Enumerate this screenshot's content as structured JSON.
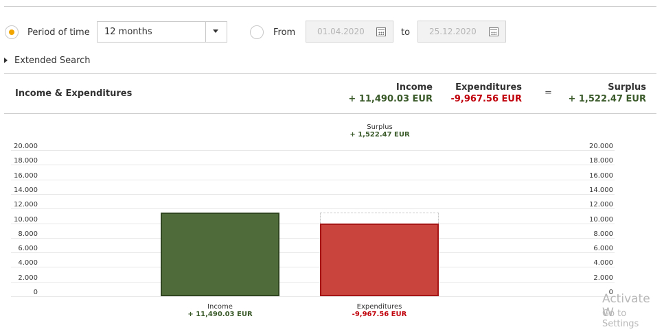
{
  "filter": {
    "period_label": "Period of time",
    "period_value": "12 months",
    "from_label": "From",
    "from_date": "01.04.2020",
    "to_label": "to",
    "to_date": "25.12.2020",
    "extended_search": "Extended Search",
    "selected": "period"
  },
  "summary": {
    "title": "Income & Expenditures",
    "income_label": "Income",
    "income_value": "+ 11,490.03 EUR",
    "expenditures_label": "Expenditures",
    "expenditures_value": "-9,967.56 EUR",
    "equals": "=",
    "surplus_label": "Surplus",
    "surplus_value": "+ 1,522.47 EUR"
  },
  "chart_data": {
    "type": "bar",
    "categories": [
      "Income",
      "Expenditures"
    ],
    "values": [
      11490.03,
      9967.56
    ],
    "value_labels": [
      "+ 11,490.03 EUR",
      "-9,967.56 EUR"
    ],
    "surplus": {
      "label": "Surplus",
      "value_text": "+ 1,522.47 EUR",
      "value": 1522.47
    },
    "ylim": [
      0,
      20000
    ],
    "yticks": [
      "20.000",
      "18.000",
      "16.000",
      "14.000",
      "12.000",
      "10.000",
      "8.000",
      "6.000",
      "4.000",
      "2.000",
      "0"
    ],
    "colors": {
      "income": "#4f6b3a",
      "income_border": "#2f4620",
      "expenditures": "#c9443c",
      "expenditures_border": "#a51515"
    },
    "grid": true
  },
  "watermark": {
    "line1": "Activate W",
    "line2": "Go to Settings"
  },
  "colors": {
    "radio_dot": "#f0a500",
    "green_text": "#3a5a2a",
    "red_text": "#c0000a"
  }
}
